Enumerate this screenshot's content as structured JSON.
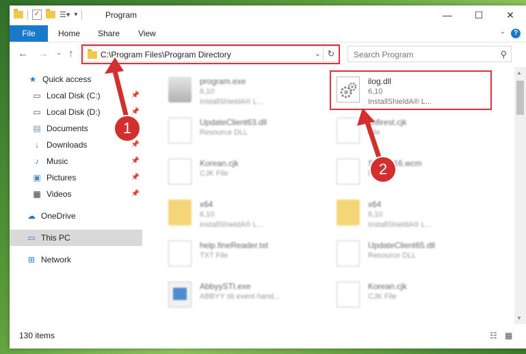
{
  "window": {
    "title": "Program",
    "minimize": "—",
    "maximize": "☐",
    "close": "✕"
  },
  "ribbon": {
    "file": "File",
    "tabs": [
      "Home",
      "Share",
      "View"
    ],
    "help": "?"
  },
  "navbar": {
    "back": "←",
    "forward": "→",
    "recent": "⌄",
    "up": "↑",
    "address": "C:\\Program Files\\Program Directory",
    "search_placeholder": "Search Program"
  },
  "sidebar": {
    "items": [
      {
        "label": "Quick access",
        "icon": "star-icon"
      },
      {
        "label": "Local Disk (C:)",
        "icon": "drive-icon",
        "pinned": true
      },
      {
        "label": "Local Disk (D:)",
        "icon": "drive-icon",
        "pinned": true
      },
      {
        "label": "Documents",
        "icon": "document-icon",
        "pinned": true
      },
      {
        "label": "Downloads",
        "icon": "download-icon",
        "pinned": true
      },
      {
        "label": "Music",
        "icon": "music-icon",
        "pinned": true
      },
      {
        "label": "Pictures",
        "icon": "picture-icon",
        "pinned": true
      },
      {
        "label": "Videos",
        "icon": "video-icon",
        "pinned": true
      },
      {
        "label": "OneDrive",
        "icon": "cloud-icon"
      },
      {
        "label": "This PC",
        "icon": "computer-icon",
        "selected": true
      },
      {
        "label": "Network",
        "icon": "network-icon"
      }
    ]
  },
  "files": [
    {
      "name": "program.exe",
      "line2": "6,10",
      "line3": "InstallShieldA® L...",
      "icon": "program-icon"
    },
    {
      "name": "ilog.dll",
      "line2": "6,10",
      "line3": "InstallShieldA® L...",
      "icon": "dll-gear-icon",
      "highlighted": true
    },
    {
      "name": "UpdateClient63.dll",
      "line2": "Resource DLL",
      "line3": "",
      "icon": "dll-gear-icon"
    },
    {
      "name": "chfirest.cjk",
      "line2": "File",
      "line3": "",
      "icon": "file-icon"
    },
    {
      "name": "Korean.cjk",
      "line2": "CJK File",
      "line3": "",
      "icon": "file-icon"
    },
    {
      "name": "SrcWP16.wcm",
      "line2": "File",
      "line3": "",
      "icon": "file-icon"
    },
    {
      "name": "x64",
      "line2": "6,10",
      "line3": "InstallShieldA® L...",
      "icon": "folder-icon"
    },
    {
      "name": "x64",
      "line2": "6,10",
      "line3": "InstallShieldA® L...",
      "icon": "folder-icon"
    },
    {
      "name": "help.fineReader.txt",
      "line2": "TXT File",
      "line3": "",
      "icon": "text-file-icon"
    },
    {
      "name": "UpdateClient65.dll",
      "line2": "Resource DLL",
      "line3": "",
      "icon": "dll-gear-icon"
    },
    {
      "name": "AbbyySTI.exe",
      "line2": "ABBYY sti event hand...",
      "line3": "",
      "icon": "app-icon"
    },
    {
      "name": "Korean.cjk",
      "line2": "CJK File",
      "line3": "",
      "icon": "file-icon"
    }
  ],
  "status": {
    "item_count": "130 items"
  },
  "callouts": [
    "1",
    "2"
  ],
  "colors": {
    "accent": "#1979ca",
    "highlight_box": "#d9323b",
    "callout": "#d32f2f"
  }
}
